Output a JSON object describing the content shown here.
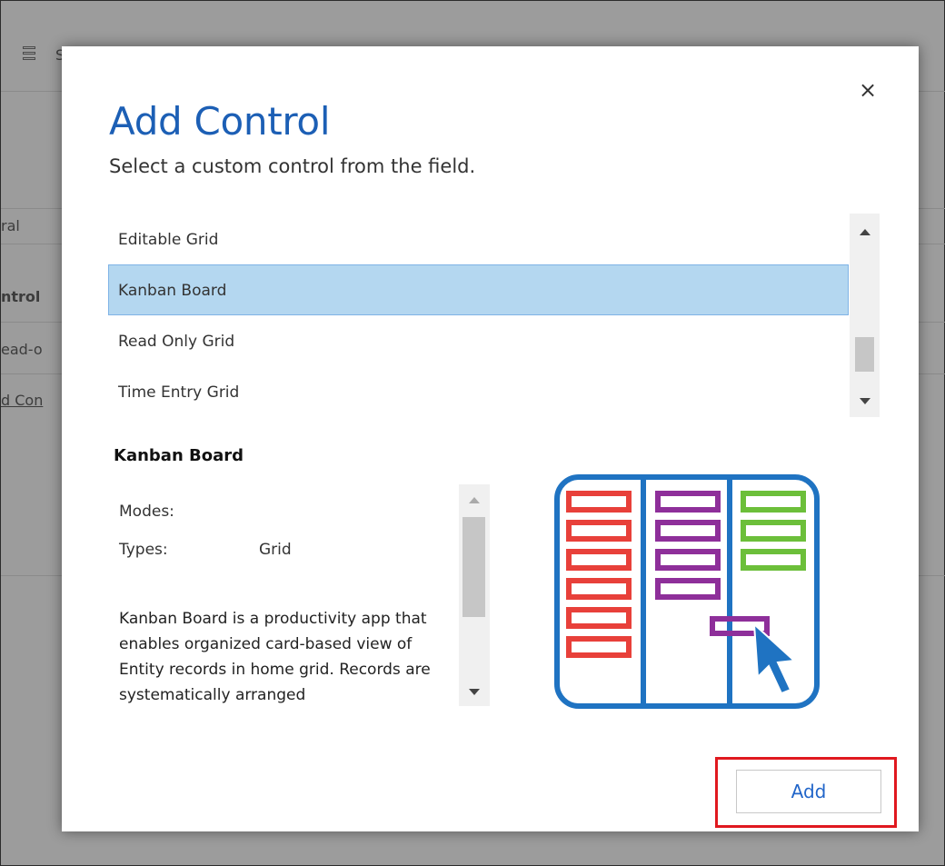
{
  "background": {
    "fragments": [
      "S",
      "ral",
      "ntrol",
      "ead-o",
      "d Con"
    ]
  },
  "dialog": {
    "close_label": "×",
    "title": "Add Control",
    "subtitle": "Select a custom control from the field.",
    "controls": [
      {
        "label": "Editable Grid",
        "selected": false
      },
      {
        "label": "Kanban Board",
        "selected": true
      },
      {
        "label": "Read Only Grid",
        "selected": false
      },
      {
        "label": "Time Entry Grid",
        "selected": false
      }
    ],
    "detail": {
      "title": "Kanban Board",
      "modes_label": "Modes:",
      "modes_value": "",
      "types_label": "Types:",
      "types_value": "Grid",
      "description": "Kanban Board is a productivity app that enables organized card-based view of Entity records in home grid. Records are systematically arranged"
    },
    "add_label": "Add"
  },
  "colors": {
    "title": "#1c5fb5",
    "selection": "#b4d7f0",
    "highlight": "#e0191f",
    "kanban_blue": "#1f73c2",
    "kanban_red": "#e8403a",
    "kanban_purple": "#8e2f9a",
    "kanban_green": "#6cbf3a"
  },
  "icons": {
    "close": "close-icon",
    "illustration": "kanban-board-illustration"
  }
}
